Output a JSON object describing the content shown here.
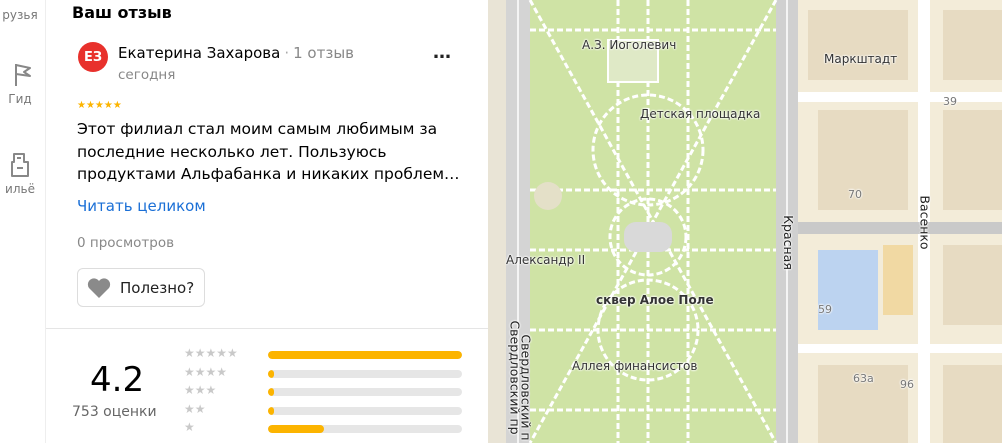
{
  "rail": {
    "items": [
      {
        "label": "рузья",
        "icon": "friends-icon"
      },
      {
        "label": "Гид",
        "icon": "guide-flag-icon"
      },
      {
        "label": "ильё",
        "icon": "housing-icon"
      }
    ]
  },
  "review": {
    "section_title": "Ваш отзыв",
    "avatar_initials": "ЕЗ",
    "avatar_color": "#e8312c",
    "author": "Екатерина Захарова",
    "author_reviews": "1 отзыв",
    "date": "сегодня",
    "rating_stars": 5,
    "text_lines": [
      "Этот филиал стал моим самым любимым за",
      "последние несколько лет. Пользуюсь",
      "продуктами Альфабанка и никаких проблем…"
    ],
    "read_more": "Читать целиком",
    "views": "0 просмотров",
    "useful_label": "Полезно?"
  },
  "summary": {
    "rating": "4.2",
    "count": "753 оценки",
    "distribution": [
      {
        "stars": 5,
        "fraction": 1.0
      },
      {
        "stars": 4,
        "fraction": 0.03
      },
      {
        "stars": 3,
        "fraction": 0.03
      },
      {
        "stars": 2,
        "fraction": 0.03
      },
      {
        "stars": 1,
        "fraction": 0.29
      }
    ]
  },
  "map": {
    "labels": {
      "monument_iogolevich": "А.З. Иоголевич",
      "playground": "Детская площадка",
      "alexander": "Александр II",
      "square": "сквер Алое Поле",
      "alley": "Аллея финансистов",
      "markshtadt": "Маркштадт",
      "street_sverdlovsky_1": "Свердловский пр",
      "street_sverdlovsky_2": "Свердловский п",
      "street_krasnaya": "Красная",
      "street_vasenko": "Васенко",
      "house_39": "39",
      "house_70": "70",
      "house_59": "59",
      "house_63a": "63а",
      "house_96": "96"
    },
    "colors": {
      "park": "#cfe3a5",
      "path": "#ffffff",
      "road": "#b5b5b5",
      "block": "#f5ecd6",
      "building": "#e6dcc7",
      "water_blue": "#bcd3f0"
    }
  }
}
